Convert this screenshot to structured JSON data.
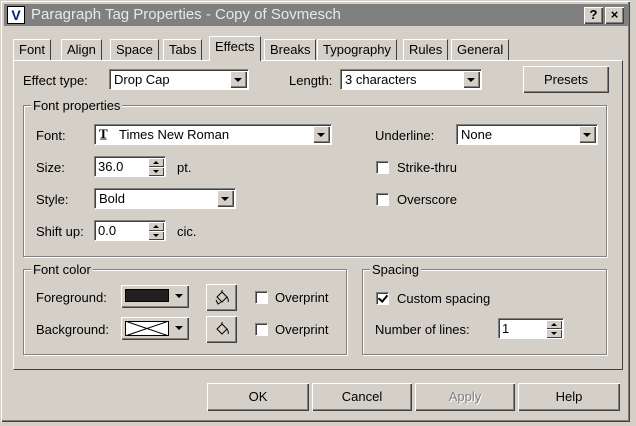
{
  "window": {
    "app_icon_letter": "V",
    "title": "Paragraph Tag Properties - Copy of Sovmesch",
    "help_btn": "?",
    "close_btn": "×"
  },
  "tabs": [
    "Font",
    "Align",
    "Space",
    "Tabs",
    "Effects",
    "Breaks",
    "Typography",
    "Rules",
    "General"
  ],
  "active_tab": "Effects",
  "effect": {
    "type_label": "Effect type:",
    "type_value": "Drop Cap",
    "length_label": "Length:",
    "length_value": "3 characters",
    "presets_label": "Presets"
  },
  "font_properties": {
    "group_label": "Font properties",
    "font_label": "Font:",
    "font_icon": "truetype-icon",
    "font_value": "Times New Roman",
    "size_label": "Size:",
    "size_value": "36.0",
    "size_unit": "pt.",
    "style_label": "Style:",
    "style_value": "Bold",
    "shift_label": "Shift up:",
    "shift_value": "0.0",
    "shift_unit": "cic.",
    "underline_label": "Underline:",
    "underline_value": "None",
    "strike_label": "Strike-thru",
    "strike_checked": false,
    "overscore_label": "Overscore",
    "overscore_checked": false
  },
  "font_color": {
    "group_label": "Font color",
    "foreground_label": "Foreground:",
    "foreground_color": "#231f20",
    "background_label": "Background:",
    "background_color": "none",
    "overprint_label": "Overprint",
    "fg_overprint_checked": false,
    "bg_overprint_checked": false
  },
  "spacing": {
    "group_label": "Spacing",
    "custom_label": "Custom spacing",
    "custom_checked": true,
    "lines_label": "Number of lines:",
    "lines_value": "1"
  },
  "footer": {
    "ok": "OK",
    "cancel": "Cancel",
    "apply": "Apply",
    "help": "Help"
  }
}
